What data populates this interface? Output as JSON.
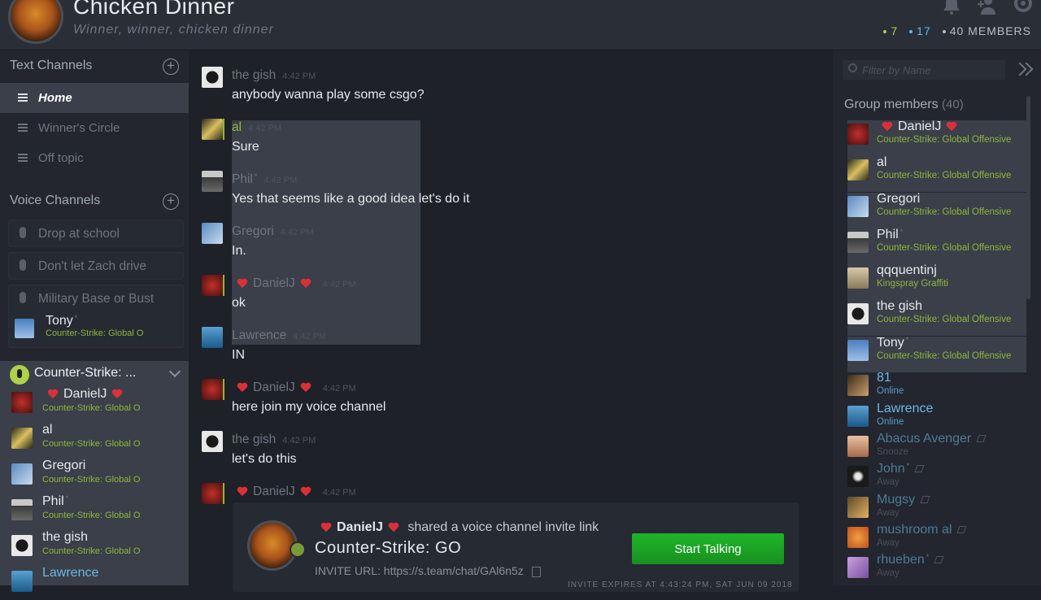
{
  "header": {
    "title": "Chicken Dinner",
    "tagline": "Winner, winner, chicken dinner",
    "count_ingame": "7",
    "count_online": "17",
    "count_members": "40 MEMBERS",
    "icons": [
      "bell-icon",
      "add-friend-icon",
      "gear-icon"
    ]
  },
  "text_channels": {
    "heading": "Text Channels",
    "items": [
      {
        "label": "Home",
        "active": true
      },
      {
        "label": "Winner's Circle",
        "active": false
      },
      {
        "label": "Off topic",
        "active": false
      }
    ]
  },
  "voice_channels": {
    "heading": "Voice Channels",
    "items": [
      {
        "label": "Drop at school"
      },
      {
        "label": "Don't let Zach drive"
      },
      {
        "label": "Military Base or Bust"
      }
    ],
    "military_user": {
      "name": "Tony",
      "status": "Counter-Strike: Global Offensive"
    }
  },
  "active_voice": {
    "title": "Counter-Strike: ...",
    "members": [
      {
        "name": "DanielJ",
        "status": "Counter-Strike: Global Offensive"
      },
      {
        "name": "al",
        "status": "Counter-Strike: Global Offensive"
      },
      {
        "name": "Gregori",
        "status": "Counter-Strike: Global Offensive"
      },
      {
        "name": "Phil",
        "status": "Counter-Strike: Global Offensive"
      },
      {
        "name": "the gish",
        "status": "Counter-Strike: Global Offensive"
      },
      {
        "name": "Lawrence",
        "status": ""
      }
    ]
  },
  "messages": [
    {
      "name": "the gish",
      "time": "4:42 PM",
      "text": "anybody wanna play some csgo?"
    },
    {
      "name": "al",
      "time": "4:42 PM",
      "text": "Sure"
    },
    {
      "name": "Phil",
      "time": "4:42 PM",
      "text": "Yes that seems like a good idea let's do it"
    },
    {
      "name": "Gregori",
      "time": "4:42 PM",
      "text": "In."
    },
    {
      "name": "DanielJ",
      "time": "4:42 PM",
      "text": "ok"
    },
    {
      "name": "Lawrence",
      "time": "4:42 PM",
      "text": "IN"
    },
    {
      "name": "DanielJ",
      "time": "4:42 PM",
      "text": "here join my voice channel"
    },
    {
      "name": "the gish",
      "time": "4:42 PM",
      "text": "let's do this"
    },
    {
      "name": "DanielJ",
      "time": "4:42 PM",
      "text": ""
    }
  ],
  "invite": {
    "sender": "DanielJ",
    "action": "shared a voice channel invite link",
    "channel": "Counter-Strike: GO",
    "url_label": "INVITE URL:",
    "url": "https://s.team/chat/GAl6n5z",
    "button": "Start Talking",
    "expires": "INVITE EXPIRES AT 4:43:24 PM, SAT JUN 09 2018"
  },
  "members_panel": {
    "filter_placeholder": "Filter by Name",
    "heading": "Group members",
    "count": "(40)",
    "members": [
      {
        "name": "DanielJ",
        "status": "Counter-Strike: Global Offensive"
      },
      {
        "name": "al",
        "status": "Counter-Strike: Global Offensive"
      },
      {
        "name": "Gregori",
        "status": "Counter-Strike: Global Offensive"
      },
      {
        "name": "Phil",
        "status": "Counter-Strike: Global Offensive"
      },
      {
        "name": "qqquentinj",
        "status": "Kingspray Graffiti"
      },
      {
        "name": "the gish",
        "status": "Counter-Strike: Global Offensive"
      },
      {
        "name": "Tony",
        "status": "Counter-Strike: Global Offensive"
      },
      {
        "name": "81",
        "status": "Online"
      },
      {
        "name": "Lawrence",
        "status": "Online"
      },
      {
        "name": "Abacus Avenger",
        "status": "Snooze"
      },
      {
        "name": "John",
        "status": "Away"
      },
      {
        "name": "Mugsy",
        "status": "Away"
      },
      {
        "name": "mushroom al",
        "status": "Away"
      },
      {
        "name": "rhueben",
        "status": "Away"
      }
    ]
  },
  "colors": {
    "ingame": "#8fb63c",
    "online": "#6cb8e8",
    "button": "#1fb52a",
    "heart": "#d9303a"
  }
}
